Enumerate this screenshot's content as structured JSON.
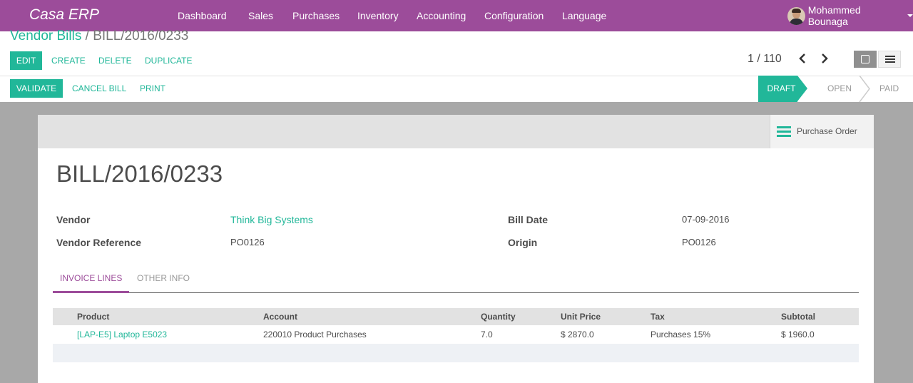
{
  "app": {
    "name": "Casa ERP"
  },
  "nav": {
    "items": [
      "Dashboard",
      "Sales",
      "Purchases",
      "Inventory",
      "Accounting",
      "Configuration",
      "Language"
    ],
    "user": "Mohammed Bounaga"
  },
  "breadcrumb": {
    "parent": "Vendor Bills",
    "separator": "/",
    "current": "BILL/2016/0233"
  },
  "toolbar": {
    "edit": "EDIT",
    "create": "CREATE",
    "delete": "DELETE",
    "duplicate": "DUPLICATE"
  },
  "pager": {
    "value": "1 / 110"
  },
  "header_buttons": {
    "validate": "VALIDATE",
    "cancel": "CANCEL BILL",
    "print": "PRINT"
  },
  "status": {
    "stages": [
      "DRAFT",
      "OPEN",
      "PAID"
    ],
    "active": "DRAFT"
  },
  "smart_button": {
    "label": "Purchase Order"
  },
  "record": {
    "title": "BILL/2016/0233",
    "fields": {
      "vendor_label": "Vendor",
      "vendor": "Think Big Systems",
      "vendor_ref_label": "Vendor Reference",
      "vendor_ref": "PO0126",
      "bill_date_label": "Bill Date",
      "bill_date": "07-09-2016",
      "origin_label": "Origin",
      "origin": "PO0126"
    }
  },
  "tabs": [
    "INVOICE LINES",
    "OTHER INFO"
  ],
  "invoice_lines": {
    "columns": [
      "Product",
      "Account",
      "Quantity",
      "Unit Price",
      "Tax",
      "Subtotal"
    ],
    "rows": [
      [
        "[LAP-E5] Laptop E5023",
        "220010 Product Purchases",
        "7.0",
        "$ 2870.0",
        "Purchases 15%",
        "$ 1960.0"
      ]
    ]
  },
  "colors": {
    "brand": "#9c4c9a",
    "accent": "#21b799"
  }
}
